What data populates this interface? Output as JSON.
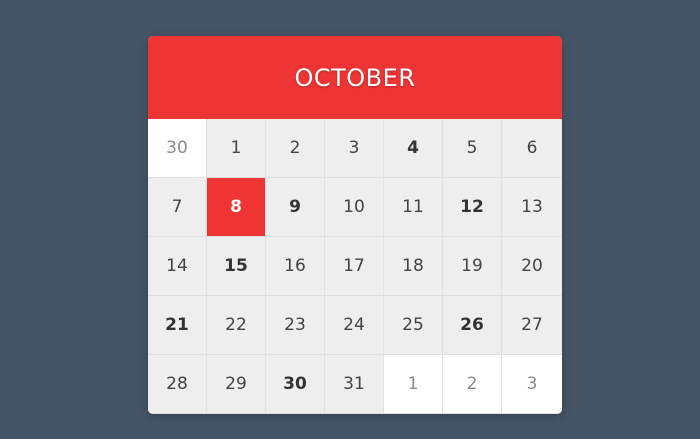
{
  "calendar": {
    "month": "OCTOBER",
    "colors": {
      "accent": "#ef3434",
      "background": "#465566",
      "cell": "#eeeeee"
    },
    "days": [
      {
        "label": "30",
        "state": "outside"
      },
      {
        "label": "1",
        "state": "normal"
      },
      {
        "label": "2",
        "state": "normal"
      },
      {
        "label": "3",
        "state": "normal"
      },
      {
        "label": "4",
        "state": "bold"
      },
      {
        "label": "5",
        "state": "normal"
      },
      {
        "label": "6",
        "state": "normal"
      },
      {
        "label": "7",
        "state": "normal"
      },
      {
        "label": "8",
        "state": "selected"
      },
      {
        "label": "9",
        "state": "bold"
      },
      {
        "label": "10",
        "state": "normal"
      },
      {
        "label": "11",
        "state": "normal"
      },
      {
        "label": "12",
        "state": "bold"
      },
      {
        "label": "13",
        "state": "normal"
      },
      {
        "label": "14",
        "state": "normal"
      },
      {
        "label": "15",
        "state": "bold"
      },
      {
        "label": "16",
        "state": "normal"
      },
      {
        "label": "17",
        "state": "normal"
      },
      {
        "label": "18",
        "state": "normal"
      },
      {
        "label": "19",
        "state": "normal"
      },
      {
        "label": "20",
        "state": "normal"
      },
      {
        "label": "21",
        "state": "bold"
      },
      {
        "label": "22",
        "state": "normal"
      },
      {
        "label": "23",
        "state": "normal"
      },
      {
        "label": "24",
        "state": "normal"
      },
      {
        "label": "25",
        "state": "normal"
      },
      {
        "label": "26",
        "state": "bold"
      },
      {
        "label": "27",
        "state": "normal"
      },
      {
        "label": "28",
        "state": "normal"
      },
      {
        "label": "29",
        "state": "normal"
      },
      {
        "label": "30",
        "state": "bold"
      },
      {
        "label": "31",
        "state": "normal"
      },
      {
        "label": "1",
        "state": "outside"
      },
      {
        "label": "2",
        "state": "outside"
      },
      {
        "label": "3",
        "state": "outside"
      }
    ]
  }
}
